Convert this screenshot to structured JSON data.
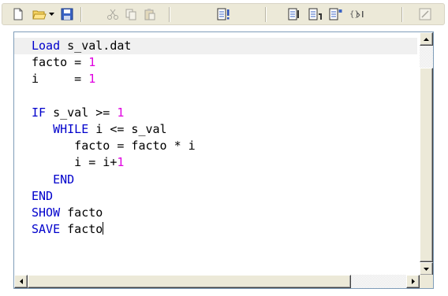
{
  "toolbar": {
    "buttons": [
      {
        "name": "new-file-icon",
        "enabled": true
      },
      {
        "name": "open-folder-icon",
        "enabled": true
      },
      {
        "name": "open-dropdown-arrow-icon",
        "enabled": true
      },
      {
        "name": "save-disk-icon",
        "enabled": true
      },
      {
        "name": "cut-icon",
        "enabled": false
      },
      {
        "name": "copy-icon",
        "enabled": false
      },
      {
        "name": "paste-icon",
        "enabled": false
      },
      {
        "name": "run-script-icon",
        "enabled": true
      },
      {
        "name": "step-icon",
        "enabled": true
      },
      {
        "name": "step-over-icon",
        "enabled": true
      },
      {
        "name": "step-into-icon",
        "enabled": true
      },
      {
        "name": "variables-icon",
        "enabled": true
      },
      {
        "name": "edit-icon",
        "enabled": false
      }
    ]
  },
  "editor": {
    "current_line": 0,
    "lines": [
      [
        {
          "t": "Load",
          "c": "kw"
        },
        {
          "t": " s_val.dat",
          "c": ""
        }
      ],
      [
        {
          "t": "facto = ",
          "c": ""
        },
        {
          "t": "1",
          "c": "num"
        }
      ],
      [
        {
          "t": "i     = ",
          "c": ""
        },
        {
          "t": "1",
          "c": "num"
        }
      ],
      [],
      [
        {
          "t": "IF",
          "c": "kw"
        },
        {
          "t": " s_val >= ",
          "c": ""
        },
        {
          "t": "1",
          "c": "num"
        }
      ],
      [
        {
          "t": "   ",
          "c": ""
        },
        {
          "t": "WHILE",
          "c": "kw"
        },
        {
          "t": " i <= s_val",
          "c": ""
        }
      ],
      [
        {
          "t": "      facto = facto * i",
          "c": ""
        }
      ],
      [
        {
          "t": "      i = i+",
          "c": ""
        },
        {
          "t": "1",
          "c": "num"
        }
      ],
      [
        {
          "t": "   ",
          "c": ""
        },
        {
          "t": "END",
          "c": "kw"
        }
      ],
      [
        {
          "t": "END",
          "c": "kw"
        }
      ],
      [
        {
          "t": "SHOW",
          "c": "kw"
        },
        {
          "t": " facto",
          "c": ""
        }
      ],
      [
        {
          "t": "SAVE",
          "c": "kw"
        },
        {
          "t": " facto",
          "c": "",
          "caret": true
        }
      ]
    ]
  },
  "scrollbars": {
    "vertical_position": 0.0,
    "horizontal_position": 0.0
  }
}
